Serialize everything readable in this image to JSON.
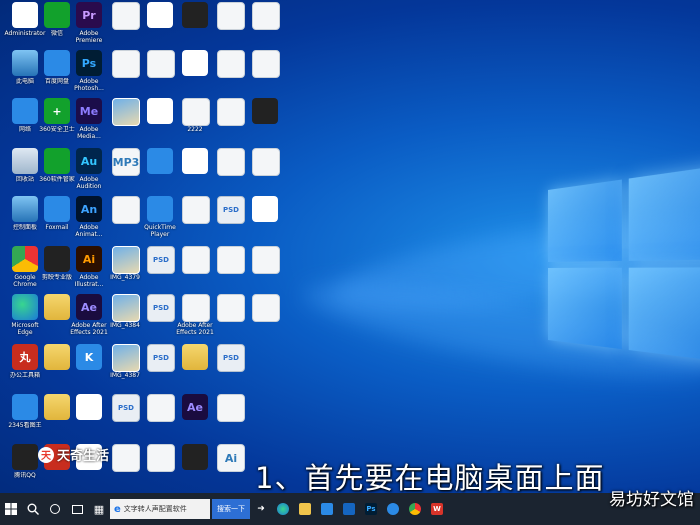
{
  "subtitle": "1、首先要在电脑桌面上面",
  "watermark": "易坊好文馆",
  "brand": {
    "mark": "天",
    "text": "天奇生活"
  },
  "taskbar": {
    "search_text": "文字转人声配置软件",
    "search_button": "搜索一下"
  },
  "icons": [
    {
      "col": 0,
      "row": 0,
      "label": "Administrator",
      "glyph": "",
      "style": "g-white"
    },
    {
      "col": 0,
      "row": 1,
      "label": "此电脑",
      "glyph": "",
      "style": "g-pc"
    },
    {
      "col": 0,
      "row": 2,
      "label": "网络",
      "glyph": "",
      "style": "g-blue"
    },
    {
      "col": 0,
      "row": 3,
      "label": "回收站",
      "glyph": "",
      "style": "g-recycle"
    },
    {
      "col": 0,
      "row": 4,
      "label": "控制面板",
      "glyph": "",
      "style": "g-pc"
    },
    {
      "col": 0,
      "row": 5,
      "label": "Google Chrome",
      "glyph": "",
      "style": "g-chrome"
    },
    {
      "col": 0,
      "row": 6,
      "label": "Microsoft Edge",
      "glyph": "",
      "style": "g-edge"
    },
    {
      "col": 0,
      "row": 7,
      "label": "办公工具箱",
      "glyph": "丸",
      "style": "g-red"
    },
    {
      "col": 0,
      "row": 8,
      "label": "2345看图王",
      "glyph": "",
      "style": "g-blue"
    },
    {
      "col": 0,
      "row": 9,
      "label": "腾讯QQ",
      "glyph": "",
      "style": "g-dark"
    },
    {
      "col": 1,
      "row": 0,
      "label": "微信",
      "glyph": "",
      "style": "g-green"
    },
    {
      "col": 1,
      "row": 1,
      "label": "百度网盘",
      "glyph": "",
      "style": "g-blue"
    },
    {
      "col": 1,
      "row": 2,
      "label": "360安全卫士",
      "glyph": "+",
      "style": "g-green"
    },
    {
      "col": 1,
      "row": 3,
      "label": "360软件管家",
      "glyph": "",
      "style": "g-green"
    },
    {
      "col": 1,
      "row": 4,
      "label": "Foxmail",
      "glyph": "",
      "style": "g-blue"
    },
    {
      "col": 1,
      "row": 5,
      "label": "剪映专业版",
      "glyph": "",
      "style": "g-dark"
    },
    {
      "col": 1,
      "row": 6,
      "label": "",
      "glyph": "",
      "style": "g-folder"
    },
    {
      "col": 1,
      "row": 7,
      "label": "",
      "glyph": "",
      "style": "g-folder"
    },
    {
      "col": 1,
      "row": 8,
      "label": "",
      "glyph": "",
      "style": "g-folder"
    },
    {
      "col": 1,
      "row": 9,
      "label": "",
      "glyph": "",
      "style": "g-red"
    },
    {
      "col": 2,
      "row": 0,
      "label": "Adobe Premiere",
      "glyph": "Pr",
      "style": "g-pr"
    },
    {
      "col": 2,
      "row": 1,
      "label": "Adobe Photosh...",
      "glyph": "Ps",
      "style": "g-ps"
    },
    {
      "col": 2,
      "row": 2,
      "label": "Adobe Media...",
      "glyph": "Me",
      "style": "g-me"
    },
    {
      "col": 2,
      "row": 3,
      "label": "Adobe Audition",
      "glyph": "Au",
      "style": "g-au"
    },
    {
      "col": 2,
      "row": 4,
      "label": "Adobe Animat...",
      "glyph": "An",
      "style": "g-an"
    },
    {
      "col": 2,
      "row": 5,
      "label": "Adobe Illustrat...",
      "glyph": "Ai",
      "style": "g-ai"
    },
    {
      "col": 2,
      "row": 6,
      "label": "Adobe After Effects 2021",
      "glyph": "Ae",
      "style": "g-ae"
    },
    {
      "col": 2,
      "row": 7,
      "label": "",
      "glyph": "K",
      "style": "g-blue"
    },
    {
      "col": 2,
      "row": 8,
      "label": "",
      "glyph": "",
      "style": "g-white"
    },
    {
      "col": 2,
      "row": 9,
      "label": "",
      "glyph": "",
      "style": "g-white"
    },
    {
      "col": 3,
      "row": 0,
      "label": "",
      "glyph": "",
      "style": "g-doc"
    },
    {
      "col": 3,
      "row": 1,
      "label": "",
      "glyph": "",
      "style": "g-doc"
    },
    {
      "col": 3,
      "row": 2,
      "label": "",
      "glyph": "",
      "style": "g-img"
    },
    {
      "col": 3,
      "row": 3,
      "label": "",
      "glyph": "MP3",
      "style": "g-doc"
    },
    {
      "col": 3,
      "row": 4,
      "label": "",
      "glyph": "",
      "style": "g-xls"
    },
    {
      "col": 3,
      "row": 5,
      "label": "IMG_4379",
      "glyph": "",
      "style": "g-img"
    },
    {
      "col": 3,
      "row": 6,
      "label": "IMG_4384",
      "glyph": "",
      "style": "g-img"
    },
    {
      "col": 3,
      "row": 7,
      "label": "IMG_4387",
      "glyph": "",
      "style": "g-img"
    },
    {
      "col": 3,
      "row": 8,
      "label": "",
      "glyph": "PSD",
      "style": "g-psd"
    },
    {
      "col": 3,
      "row": 9,
      "label": "",
      "glyph": "",
      "style": "g-doc"
    },
    {
      "col": 4,
      "row": 0,
      "label": "",
      "glyph": "",
      "style": "g-white"
    },
    {
      "col": 4,
      "row": 1,
      "label": "",
      "glyph": "",
      "style": "g-doc"
    },
    {
      "col": 4,
      "row": 2,
      "label": "",
      "glyph": "",
      "style": "g-white"
    },
    {
      "col": 4,
      "row": 3,
      "label": "",
      "glyph": "",
      "style": "g-blue"
    },
    {
      "col": 4,
      "row": 4,
      "label": "QuickTime Player",
      "glyph": "",
      "style": "g-blue"
    },
    {
      "col": 4,
      "row": 5,
      "label": "",
      "glyph": "PSD",
      "style": "g-psd"
    },
    {
      "col": 4,
      "row": 6,
      "label": "",
      "glyph": "PSD",
      "style": "g-psd"
    },
    {
      "col": 4,
      "row": 7,
      "label": "",
      "glyph": "PSD",
      "style": "g-psd"
    },
    {
      "col": 4,
      "row": 8,
      "label": "",
      "glyph": "",
      "style": "g-doc"
    },
    {
      "col": 4,
      "row": 9,
      "label": "",
      "glyph": "",
      "style": "g-doc"
    },
    {
      "col": 5,
      "row": 0,
      "label": "",
      "glyph": "",
      "style": "g-dark"
    },
    {
      "col": 5,
      "row": 1,
      "label": "",
      "glyph": "",
      "style": "g-white"
    },
    {
      "col": 5,
      "row": 2,
      "label": "2222",
      "glyph": "",
      "style": "g-doc"
    },
    {
      "col": 5,
      "row": 3,
      "label": "",
      "glyph": "",
      "style": "g-white"
    },
    {
      "col": 5,
      "row": 4,
      "label": "",
      "glyph": "",
      "style": "g-doc"
    },
    {
      "col": 5,
      "row": 5,
      "label": "",
      "glyph": "",
      "style": "g-doc"
    },
    {
      "col": 5,
      "row": 6,
      "label": "Adobe After Effects 2021",
      "glyph": "",
      "style": "g-doc"
    },
    {
      "col": 5,
      "row": 7,
      "label": "",
      "glyph": "",
      "style": "g-folder"
    },
    {
      "col": 5,
      "row": 8,
      "label": "",
      "glyph": "Ae",
      "style": "g-ae"
    },
    {
      "col": 5,
      "row": 9,
      "label": "",
      "glyph": "",
      "style": "g-dark"
    },
    {
      "col": 6,
      "row": 0,
      "label": "",
      "glyph": "",
      "style": "g-word"
    },
    {
      "col": 6,
      "row": 1,
      "label": "",
      "glyph": "",
      "style": "g-doc"
    },
    {
      "col": 6,
      "row": 2,
      "label": "",
      "glyph": "",
      "style": "g-word"
    },
    {
      "col": 6,
      "row": 3,
      "label": "",
      "glyph": "",
      "style": "g-word"
    },
    {
      "col": 6,
      "row": 4,
      "label": "",
      "glyph": "PSD",
      "style": "g-psd"
    },
    {
      "col": 6,
      "row": 5,
      "label": "",
      "glyph": "",
      "style": "g-xls"
    },
    {
      "col": 6,
      "row": 6,
      "label": "",
      "glyph": "",
      "style": "g-xls"
    },
    {
      "col": 6,
      "row": 7,
      "label": "",
      "glyph": "PSD",
      "style": "g-psd"
    },
    {
      "col": 6,
      "row": 8,
      "label": "",
      "glyph": "",
      "style": "g-doc"
    },
    {
      "col": 6,
      "row": 9,
      "label": "",
      "glyph": "Ai",
      "style": "g-doc"
    },
    {
      "col": 7,
      "row": 0,
      "label": "",
      "glyph": "",
      "style": "g-xls"
    },
    {
      "col": 7,
      "row": 1,
      "label": "",
      "glyph": "",
      "style": "g-xls"
    },
    {
      "col": 7,
      "row": 2,
      "label": "",
      "glyph": "",
      "style": "g-dark"
    },
    {
      "col": 7,
      "row": 3,
      "label": "",
      "glyph": "",
      "style": "g-xls"
    },
    {
      "col": 7,
      "row": 4,
      "label": "",
      "glyph": "",
      "style": "g-white"
    },
    {
      "col": 7,
      "row": 5,
      "label": "",
      "glyph": "",
      "style": "g-xls"
    },
    {
      "col": 7,
      "row": 6,
      "label": "",
      "glyph": "",
      "style": "g-xls"
    }
  ]
}
